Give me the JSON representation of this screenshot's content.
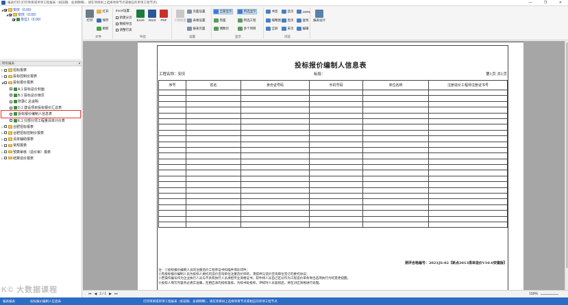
{
  "window": {
    "title": "报表打印  (打印项目或单项工程报表（如前期、总调明细），请在项目树上选择项目节点或相应的单项工程节点)",
    "controls": [
      "—",
      "❐",
      "✕"
    ]
  },
  "project_tree": [
    {
      "label": "安庆（0.00）",
      "level": 0,
      "checked": true
    },
    {
      "label": "安庆（0.00）",
      "level": 1,
      "checked": true
    },
    {
      "label": "单位1（0.00）",
      "level": 2,
      "checked": true
    }
  ],
  "report_tree": {
    "header": "所有报表",
    "items": [
      {
        "label": "招标报表",
        "level": 0,
        "type": "folder"
      },
      {
        "label": "投标控制价报表",
        "level": 0,
        "type": "folder"
      },
      {
        "label": "投标报价报表",
        "level": 0,
        "type": "folder",
        "expanded": true
      },
      {
        "label": "A.1 投标总价封面",
        "level": 1,
        "type": "doc"
      },
      {
        "label": "B.1 投标总价扉页",
        "level": 1,
        "type": "doc"
      },
      {
        "label": "附录C 总说明",
        "level": 1,
        "type": "doc"
      },
      {
        "label": "D.1 建设项目投标报价汇总表",
        "level": 1,
        "type": "doc"
      },
      {
        "label": "投标报价编制人信息表",
        "level": 1,
        "type": "doc",
        "selected": true
      },
      {
        "label": "E.1 分部分项工程量清单计价表",
        "level": 1,
        "type": "doc"
      },
      {
        "label": "合肥招标报表",
        "level": 0,
        "type": "folder"
      },
      {
        "label": "合肥招标控制价报表",
        "level": 0,
        "type": "folder"
      },
      {
        "label": "清单辅助报表",
        "level": 0,
        "type": "folder"
      },
      {
        "label": "常规报表",
        "level": 0,
        "type": "folder"
      },
      {
        "label": "预算审核（造价审）报表",
        "level": 0,
        "type": "folder"
      },
      {
        "label": "结算造价报表",
        "level": 0,
        "type": "folder"
      }
    ]
  },
  "ribbon": {
    "file": {
      "label": "文件",
      "print": "打印",
      "open": "打开",
      "save": "保存",
      "refresh": "刷新"
    },
    "export": {
      "label": "导出",
      "excel_settings": "Excel设置",
      "new_sheet": "新建分页",
      "data_only": "数据导出",
      "adjust_width": "调整行高",
      "excel": "Excel",
      "word": "Word",
      "pdf": "PDF"
    },
    "settings": {
      "label": "设置",
      "workbook_label": "工程标签",
      "page_setup": "页面设置",
      "table_settings": "表格设置",
      "report_settings": "报表页面"
    },
    "display": {
      "label": "显示",
      "show_all": "全部显示",
      "cover": "卷面",
      "odd_page": "奇数页",
      "even_page": "偶数页",
      "selected_show": "所选显示",
      "filter_project": "所选工程",
      "multi_item": "多个项目"
    },
    "browse": {
      "label": "浏览",
      "bookmark": "书签",
      "thumbnail": "缩略图",
      "full_width": "全屏",
      "first_page": "首页",
      "prev_page": "前页",
      "next_page": "后页",
      "last_page": "末页",
      "zoom": "100%",
      "find": "查找",
      "edit": "编辑"
    },
    "design": {
      "label": "",
      "report_design": "报表设计"
    }
  },
  "document": {
    "title": "投标报价编制人信息表",
    "project_label": "工程名称：安庆",
    "section_label": "标段：",
    "page_label": "第1页  共1页",
    "columns": [
      "序号",
      "姓名",
      "身份证号码",
      "手机号码",
      "单位名称",
      "注册造价工程师注册证书号"
    ],
    "empty_rows": 24,
    "footer_code": "测评合格编号：2021JS-02【新点2013清单造价V10.0安徽版】",
    "notes": [
      "注：①投标报价编制人员的注册造价工程师证书扫描件或彩印件；",
      "②有投标报价编制人员为投标人委托的造价咨询单位注册造价师的，须提供与造价咨询单位签订的委托协议；",
      "③若操作编号作为企业执行人员与不具有执行人员承担专业资格证书，软件将人员自己区分作为工程造价单条导出选项执行为的变更提醒。",
      "④投标人填写内容务必真实准确，在相应表的投标复核，为标书处投标，评标时人员复核后，将在对应资格进行处理。"
    ]
  },
  "navbar": {
    "first": "⏮",
    "prev": "◀",
    "page": "1 / 1",
    "next": "▶",
    "last": "⏭",
    "zoom": "150%"
  },
  "statusbar": {
    "left": "报表报表",
    "current": "投标报价编制人信息表",
    "hint": "打印项目或单项工程报表（如前期、总调明细），请在项目树上选择项目节点或相应的单项工程节点"
  },
  "watermark": "K© 大数据课程",
  "colors": {
    "accent": "#2b6cc4",
    "selection": "#cfe3f7",
    "highlight": "#e23232"
  }
}
